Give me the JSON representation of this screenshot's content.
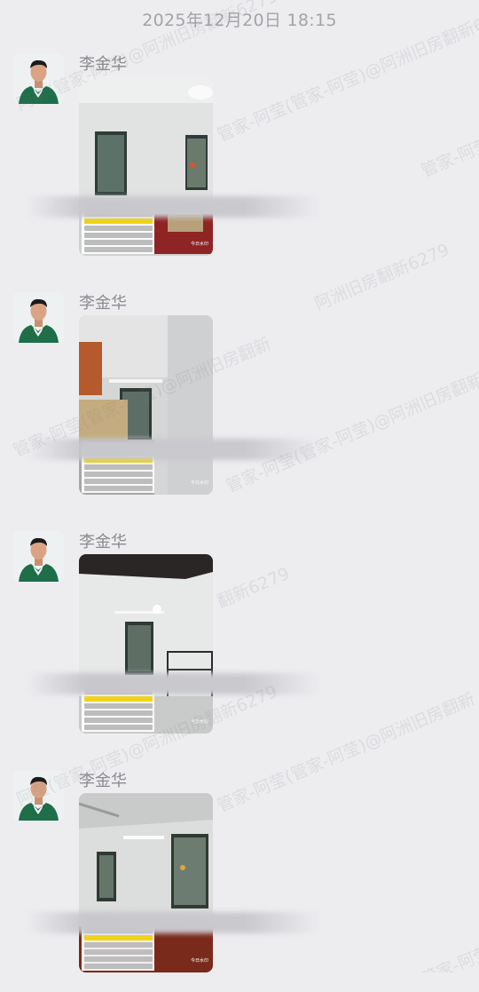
{
  "header": {
    "timestamp": "2025年12月20日  18:15"
  },
  "messages": [
    {
      "sender": "李金华"
    },
    {
      "sender": "李金华"
    },
    {
      "sender": "李金华"
    },
    {
      "sender": "李金华"
    }
  ],
  "watermarks": [
    "阿琏(管家-阿莹)@阿洲旧房翻新6279",
    "管家-阿莹(管家-阿莹)@阿洲旧房翻新6279",
    "管家-阿莹",
    "阿洲旧房翻新6279",
    "管家-阿莹(管家-阿莹)@阿洲旧房翻新",
    "翻新6279",
    "管家-阿莹(管家-阿莹)@阿洲旧房翻新",
    "管家-阿莹(管家-阿莹)@阿洲旧房翻新",
    "阿莹(管家-阿莹)@阿洲旧房翻新6279",
    "管家-阿莹"
  ],
  "photo_badge": "今日水印"
}
